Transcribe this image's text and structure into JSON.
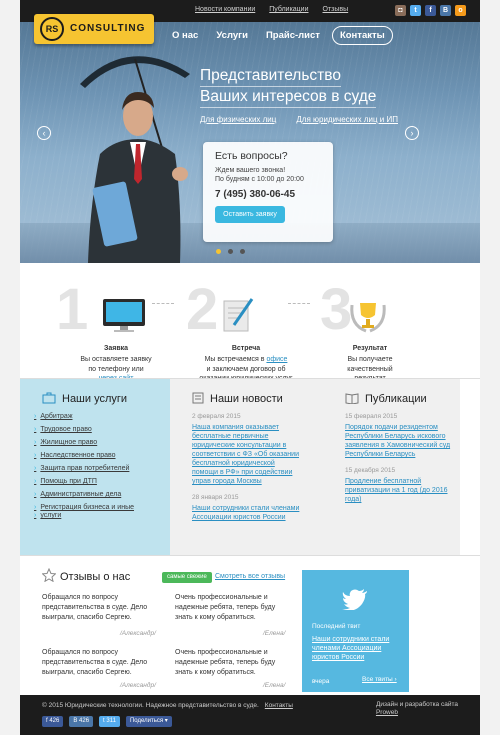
{
  "topbar": {
    "links": [
      "Новости компании",
      "Публикации",
      "Отзывы"
    ]
  },
  "logo": {
    "mark": "RS",
    "text": "CONSULTING"
  },
  "nav": {
    "items": [
      "О нас",
      "Услуги",
      "Прайс-лист",
      "Контакты"
    ]
  },
  "hero": {
    "headline_1": "Представительство",
    "headline_2": "Ваших интересов в суде",
    "link_individuals": "Для физических лиц",
    "link_legal": "Для юридических лиц и ИП",
    "prev": "‹",
    "next": "›"
  },
  "question_box": {
    "title": "Есть вопросы?",
    "subtitle_1": "Ждем вашего звонка!",
    "subtitle_2": "По будням с 10:00 до 20:00",
    "phone": "7 (495) 380-06-45",
    "button": "Оставить заявку"
  },
  "steps": [
    {
      "num": "1",
      "title": "Заявка",
      "text_1": "Вы оставляете заявку",
      "text_2": "по телефону или",
      "link": "через сайт"
    },
    {
      "num": "2",
      "title": "Встреча",
      "text_1": "Мы встречаемся в ",
      "link": "офисе",
      "text_2": "и заключаем договор об",
      "text_3": "оказании юридических услуг"
    },
    {
      "num": "3",
      "title": "Результат",
      "text_1": "Вы получаете",
      "text_2": "качественный",
      "text_3": "результат"
    }
  ],
  "services": {
    "title": "Наши услуги",
    "items": [
      "Арбитраж",
      "Трудовое право",
      "Жилищное право",
      "Наследственное право",
      "Защита прав потребителей",
      "Помощь при ДТП",
      "Административные дела",
      "Регистрация бизнеса и иные",
      "услуги"
    ]
  },
  "news": {
    "title": "Наши новости",
    "items": [
      {
        "date": "2 февраля 2015",
        "lines": [
          "Наша компания оказывает",
          "бесплатные первичные",
          "юридические консультации в",
          "соответствии с ФЗ «Об оказании",
          "бесплатной юридической",
          "помощи в РФ» при содействии",
          "управ города Москвы"
        ]
      },
      {
        "date": "28 января 2015",
        "lines": [
          "Наши сотрудники стали членами",
          "Ассоциации юристов России"
        ]
      }
    ]
  },
  "publications": {
    "title": "Публикации",
    "items": [
      {
        "date": "15 февраля 2015",
        "lines": [
          "Порядок подачи резидентом",
          "Республики Беларусь искового",
          "заявления в Хамовнический суд",
          "Республики Беларусь"
        ]
      },
      {
        "date": "15 декабря 2015",
        "lines": [
          "Продление бесплатной",
          "приватизации на 1 год (до 2016",
          "года)"
        ]
      }
    ]
  },
  "reviews": {
    "title": "Отзывы о нас",
    "badge": "самые свежие",
    "all": "Смотреть все отзывы",
    "items": [
      {
        "lines": [
          "Обращался по вопросу",
          "представительства в суде. Дело",
          "выиграли, спасибо Сергею."
        ],
        "name": "/Александр/"
      },
      {
        "lines": [
          "Очень профессиональные и",
          "надежные ребята, теперь буду",
          "знать к кому обратиться."
        ],
        "name": "/Елена/"
      },
      {
        "lines": [
          "Обращался по вопросу",
          "представительства в суде. Дело",
          "выиграли, спасибо Сергею."
        ],
        "name": "/Александр/"
      },
      {
        "lines": [
          "Очень профессиональные и",
          "надежные ребята, теперь буду",
          "знать к кому обратиться."
        ],
        "name": "/Елена/"
      }
    ]
  },
  "twitter": {
    "label": "Последний твит",
    "lines": [
      "Наши сотрудники стали",
      "членами Ассоциации",
      "юристов России"
    ],
    "time": "вчера",
    "all": "Все твиты ›"
  },
  "footer": {
    "copy": "© 2015 Юридические технологии. Надежное представительство в суде.",
    "contacts": "Контакты",
    "dev_1": "Дизайн и разработка сайта",
    "dev_2": "Proweb",
    "shares": [
      {
        "label": "f  426",
        "color": "#3b5998"
      },
      {
        "label": "В  426",
        "color": "#4a76a8"
      },
      {
        "label": "t  311",
        "color": "#55acee"
      },
      {
        "label": "Поделиться ▾",
        "color": "#3b5998"
      }
    ]
  },
  "colors": {
    "accent": "#3ab8e0",
    "logo": "#f6c431",
    "link": "#2a8fc2",
    "dark": "#1c1c1c"
  }
}
